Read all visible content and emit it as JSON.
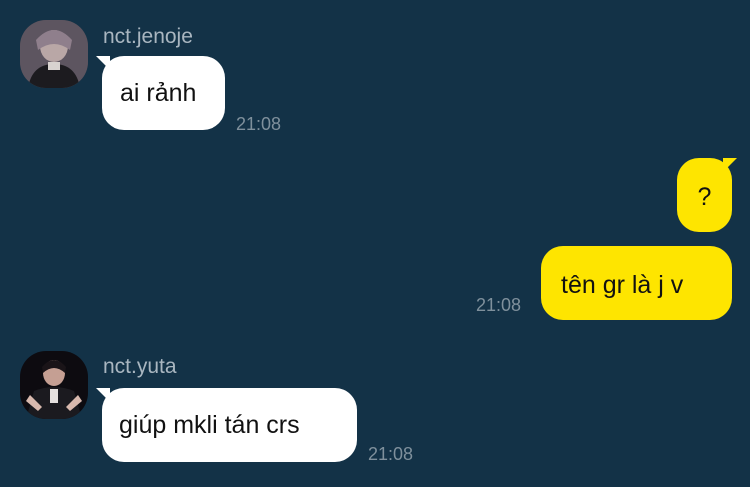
{
  "messages": [
    {
      "sender": "nct.jenoje",
      "text": "ai rảnh",
      "time": "21:08",
      "avatar_icon": "profile-photo"
    },
    {
      "outgoing": [
        {
          "text": "?"
        },
        {
          "text": "tên gr là j v",
          "time": "21:08"
        }
      ]
    },
    {
      "sender": "nct.yuta",
      "text": "giúp mkli tán crs",
      "time": "21:08",
      "avatar_icon": "profile-photo"
    }
  ],
  "colors": {
    "background": "#133247",
    "incoming_bubble": "#ffffff",
    "outgoing_bubble": "#fee500",
    "sender_name": "#a9b6c0",
    "timestamp": "#7f909c"
  }
}
